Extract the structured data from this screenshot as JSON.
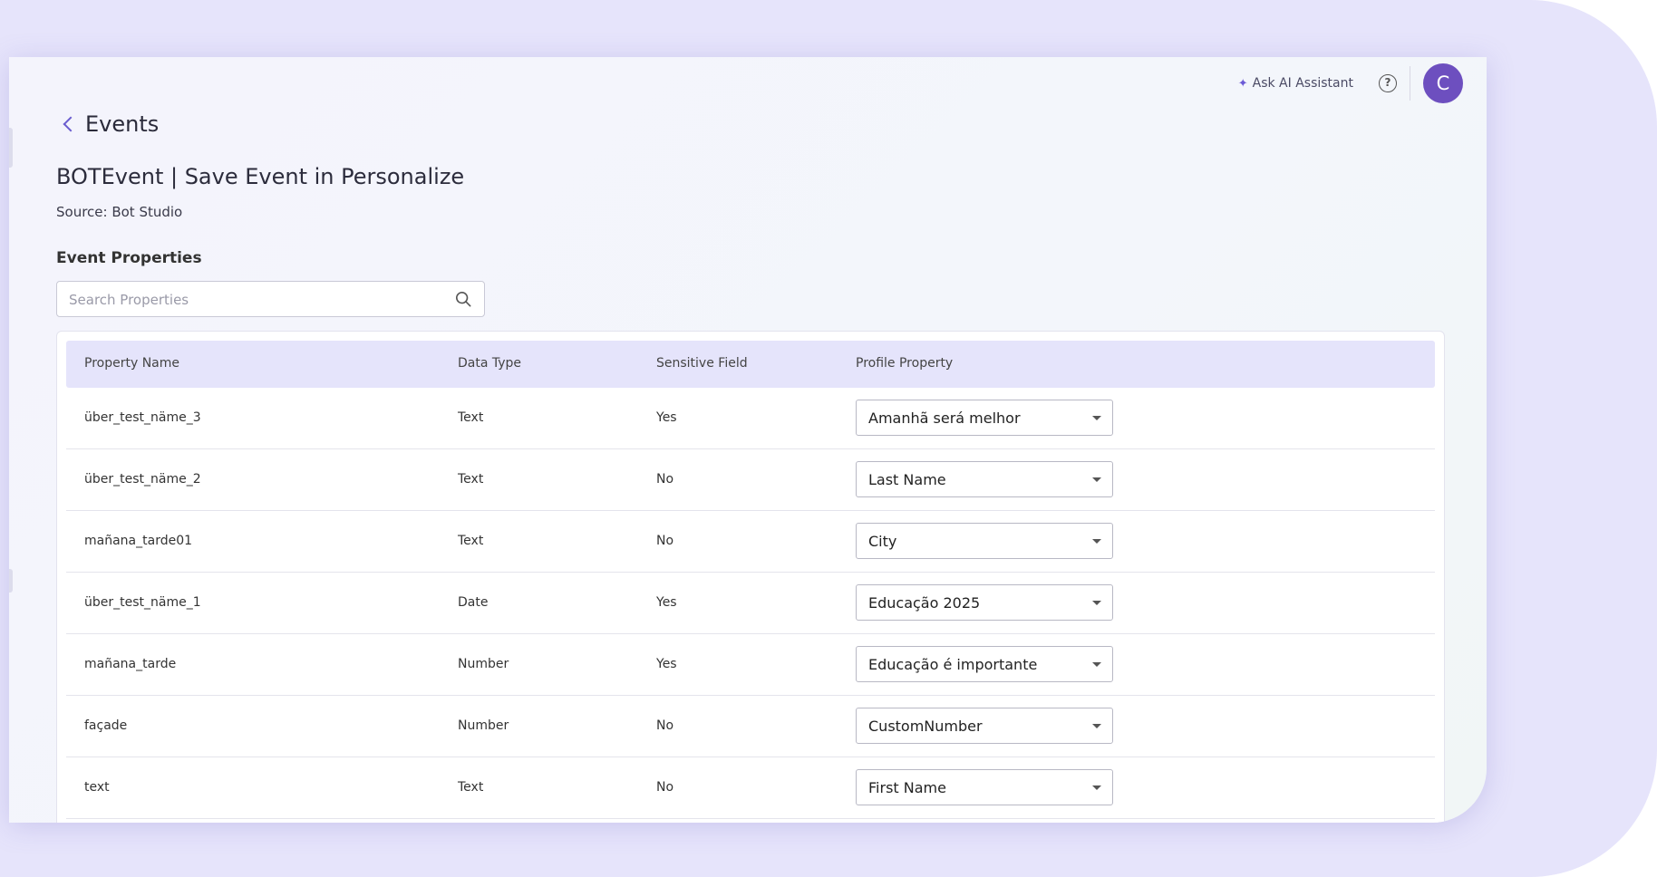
{
  "header": {
    "ai_assistant_label": "Ask AI Assistant",
    "avatar_initial": "C"
  },
  "nav": {
    "back_label": "Events"
  },
  "event": {
    "title": "BOTEvent | Save Event in Personalize",
    "source": "Source: Bot Studio"
  },
  "properties": {
    "section_title": "Event Properties",
    "search_placeholder": "Search Properties",
    "columns": [
      "Property Name",
      "Data Type",
      "Sensitive Field",
      "Profile Property"
    ],
    "rows": [
      {
        "name": "über_test_näme_3",
        "type": "Text",
        "sensitive": "Yes",
        "profile": "Amanhã será melhor"
      },
      {
        "name": "über_test_näme_2",
        "type": "Text",
        "sensitive": "No",
        "profile": "Last Name"
      },
      {
        "name": "mañana_tarde01",
        "type": "Text",
        "sensitive": "No",
        "profile": "City"
      },
      {
        "name": "über_test_näme_1",
        "type": "Date",
        "sensitive": "Yes",
        "profile": "Educação 2025"
      },
      {
        "name": "mañana_tarde",
        "type": "Number",
        "sensitive": "Yes",
        "profile": "Educação é importante"
      },
      {
        "name": "façade",
        "type": "Number",
        "sensitive": "No",
        "profile": "CustomNumber"
      },
      {
        "name": "text",
        "type": "Text",
        "sensitive": "No",
        "profile": "First Name"
      }
    ]
  },
  "colors": {
    "accent": "#6d4fbf",
    "header_bg": "#e5e4fb",
    "backdrop": "#e6e4fb"
  }
}
